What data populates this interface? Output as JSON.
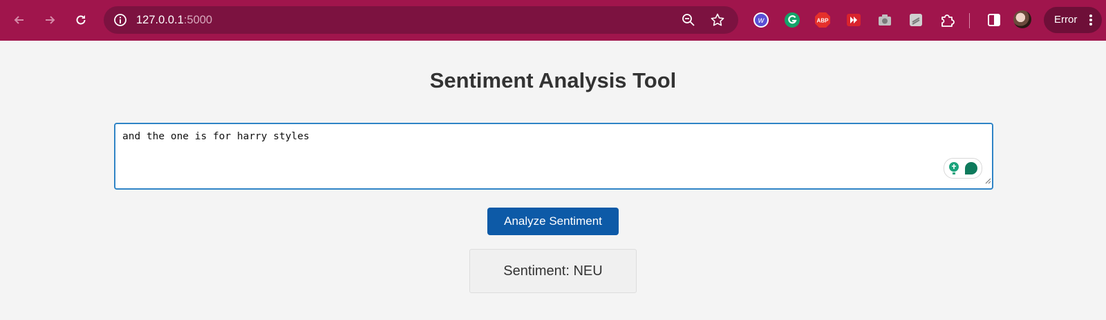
{
  "browser": {
    "url_host": "127.0.0.1",
    "url_port": ":5000",
    "extensions": [
      "webflow-icon",
      "grammarly-icon",
      "adblock-plus-icon",
      "video-speed-icon",
      "camera-icon",
      "stack-icon",
      "puzzle-icon"
    ],
    "adblock_label": "ABP",
    "profile_status": "Error"
  },
  "page": {
    "title": "Sentiment Analysis Tool",
    "input_text": "and the one is for harry styles",
    "button_label": "Analyze Sentiment",
    "result_text": "Sentiment: NEU"
  },
  "colors": {
    "chrome": "#a0154c",
    "button": "#0d5aa7",
    "textarea_border": "#2f84c6"
  }
}
